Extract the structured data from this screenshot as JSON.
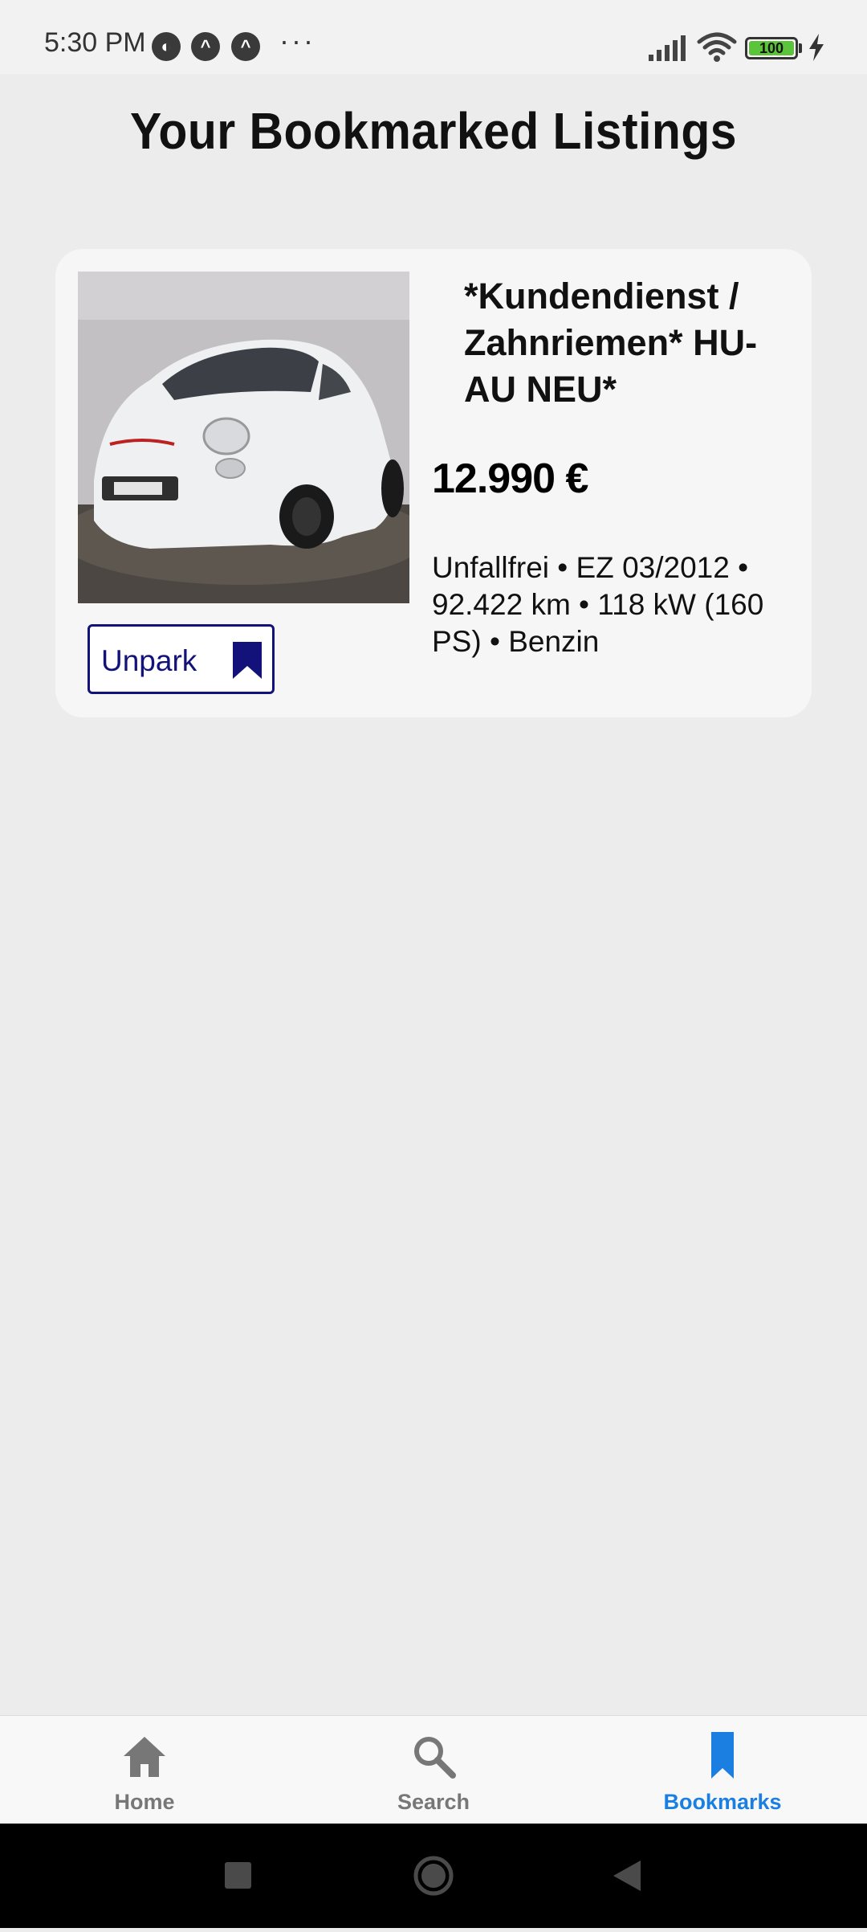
{
  "status_bar": {
    "time": "5:30 PM",
    "battery_level": "100",
    "app_icons": [
      "notification-app-icon",
      "caret-app-icon",
      "caret-app-icon"
    ],
    "overflow": "···"
  },
  "page": {
    "title": "Your Bookmarked Listings"
  },
  "listings": [
    {
      "title": "*Kundendienst / Zahnriemen* HU-AU NEU*",
      "price": "12.990 €",
      "details": "Unfallfrei • EZ 03/2012 • 92.422 km • 118 kW (160 PS) • Benzin",
      "unpark_label": "Unpark",
      "image_icon": "car-photo"
    }
  ],
  "bottom_nav": {
    "items": [
      {
        "label": "Home",
        "icon": "home-icon",
        "active": false
      },
      {
        "label": "Search",
        "icon": "search-icon",
        "active": false
      },
      {
        "label": "Bookmarks",
        "icon": "bookmark-icon",
        "active": true
      }
    ],
    "active_color": "#1a7fe0",
    "inactive_color": "#777777"
  },
  "colors": {
    "background": "#ececec",
    "card": "#f6f6f6",
    "unpark_accent": "#12127a"
  }
}
